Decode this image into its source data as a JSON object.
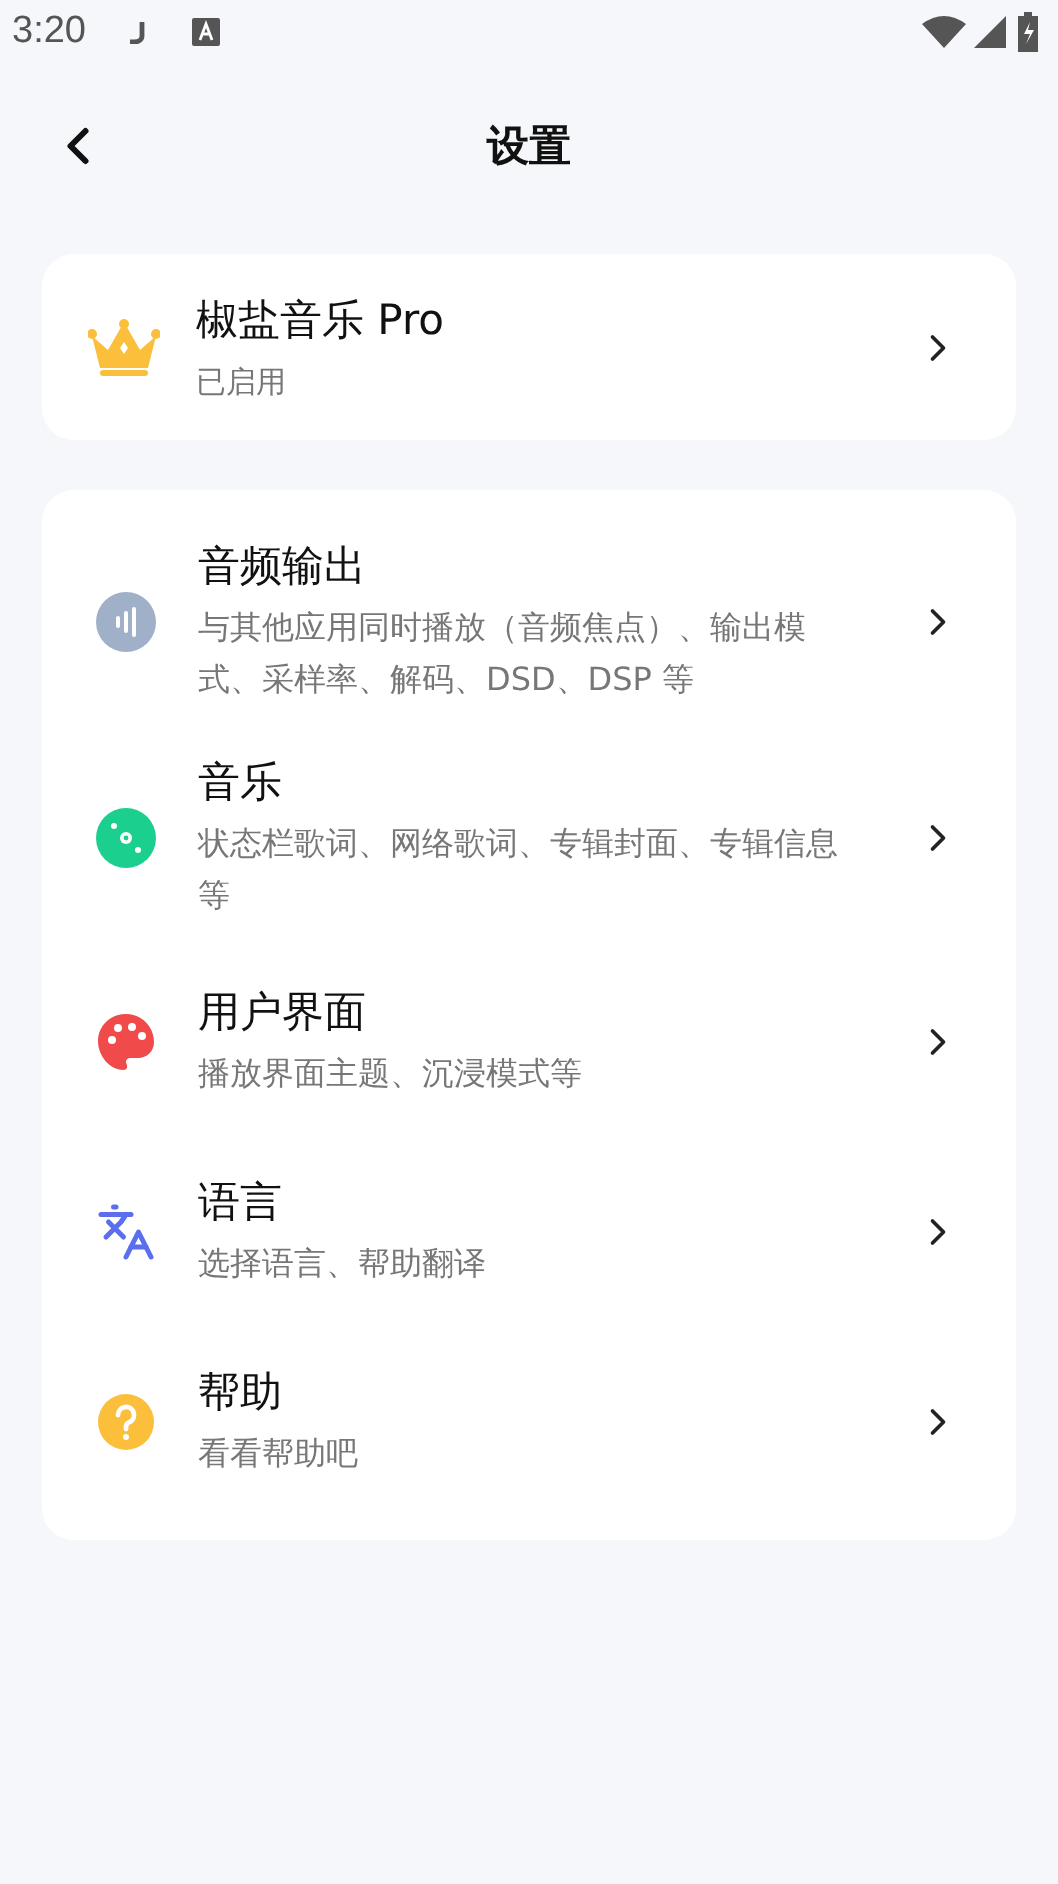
{
  "status_bar": {
    "time": "3:20"
  },
  "header": {
    "title": "设置"
  },
  "pro": {
    "title": "椒盐音乐 Pro",
    "subtitle": "已启用"
  },
  "items": [
    {
      "kind": "audio",
      "title": "音频输出",
      "subtitle": "与其他应用同时播放（音频焦点）、输出模式、采样率、解码、DSD、DSP 等"
    },
    {
      "kind": "music",
      "title": "音乐",
      "subtitle": "状态栏歌词、网络歌词、专辑封面、专辑信息等"
    },
    {
      "kind": "ui",
      "title": "用户界面",
      "subtitle": "播放界面主题、沉浸模式等"
    },
    {
      "kind": "language",
      "title": "语言",
      "subtitle": "选择语言、帮助翻译"
    },
    {
      "kind": "help",
      "title": "帮助",
      "subtitle": "看看帮助吧"
    }
  ]
}
